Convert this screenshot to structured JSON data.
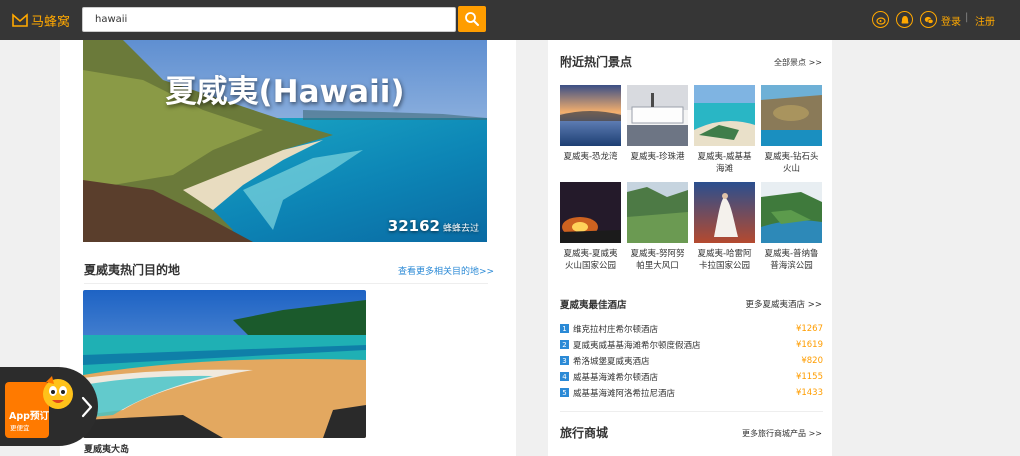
{
  "header": {
    "logo_text": "马蜂窝",
    "search": {
      "value": "hawaii"
    },
    "login": "登录",
    "separator": "|",
    "register": "注册",
    "social_icons": [
      "weibo-icon",
      "qq-icon",
      "wechat-icon"
    ]
  },
  "hero": {
    "title": "夏威夷(Hawaii)",
    "visited_count": "32162",
    "visited_label": "蜂蜂去过"
  },
  "popular": {
    "title": "夏威夷热门目的地",
    "more": "查看更多相关目的地>>",
    "items": [
      {
        "name": "夏威夷大岛"
      }
    ]
  },
  "nearby": {
    "title": "附近热门景点",
    "more": "全部景点 >>",
    "spots": [
      {
        "line1": "夏威夷-恐龙湾",
        "line2": ""
      },
      {
        "line1": "夏威夷-珍珠港",
        "line2": ""
      },
      {
        "line1": "夏威夷-威基基",
        "line2": "海滩"
      },
      {
        "line1": "夏威夷-钻石头",
        "line2": "火山"
      },
      {
        "line1": "夏威夷-夏威夷",
        "line2": "火山国家公园"
      },
      {
        "line1": "夏威夷-努阿努",
        "line2": "帕里大风口"
      },
      {
        "line1": "夏威夷-哈雷阿",
        "line2": "卡拉国家公园"
      },
      {
        "line1": "夏威夷-普纳鲁",
        "line2": "普海滨公园"
      }
    ]
  },
  "hotels": {
    "title": "夏威夷最佳酒店",
    "more": "更多夏威夷酒店 >>",
    "items": [
      {
        "rank": "1",
        "name": "维克拉村庄希尔顿酒店",
        "price": "¥1267"
      },
      {
        "rank": "2",
        "name": "夏威夷威基基海滩希尔顿度假酒店",
        "price": "¥1619"
      },
      {
        "rank": "3",
        "name": "希洛城堡夏威夷酒店",
        "price": "¥820"
      },
      {
        "rank": "4",
        "name": "威基基海滩希尔顿酒店",
        "price": "¥1155"
      },
      {
        "rank": "5",
        "name": "威基基海滩阿洛希拉尼酒店",
        "price": "¥1433"
      }
    ]
  },
  "mall": {
    "title": "旅行商城",
    "more": "更多旅行商城产品 >>"
  },
  "app_promo": {
    "label": "App预订",
    "sub": "更便宜"
  },
  "colors": {
    "accent": "#ff9d00",
    "topbar": "#363636",
    "link": "#2b8ad6"
  }
}
